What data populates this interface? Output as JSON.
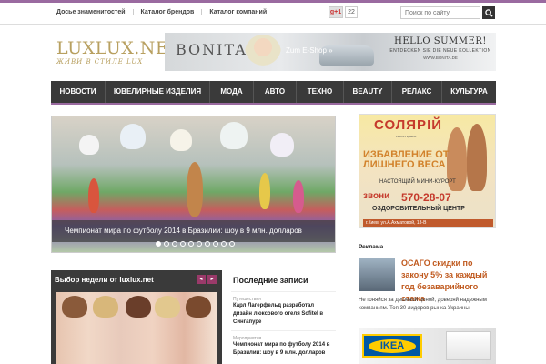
{
  "topbar": {
    "links": [
      "Досье знаменитостей",
      "Каталог брендов",
      "Каталог компаний"
    ],
    "gplus_label": "g+1",
    "gplus_count": "22",
    "search_placeholder": "Поиск по сайту"
  },
  "logo": {
    "name": "LUXLUX.NET",
    "tagline": "ЖИВИ В СТИЛЕ LUX"
  },
  "banner": {
    "brand": "BONITA",
    "shop": "Zum E-Shop »",
    "hello": "HELLO SUMMER!",
    "sub": "ENTDECKEN SIE DIE NEUE KOLLEKTION",
    "url": "WWW.BONITA.DE"
  },
  "nav": {
    "items": [
      "НОВОСТИ",
      "ЮВЕЛИРНЫЕ ИЗДЕЛИЯ",
      "МОДА",
      "АВТО",
      "ТЕХНО",
      "BEAUTY",
      "РЕЛАКС",
      "КУЛЬТУРА"
    ]
  },
  "slider": {
    "caption": "Чемпионат мира по футболу 2014 в Бразилии: шоу в 9 млн. долларов",
    "active_index": 0,
    "dot_count": 10
  },
  "week": {
    "title": "Выбор недели от luxlux.net",
    "prev": "◂",
    "next": "▸"
  },
  "recent": {
    "title": "Последние записи",
    "items": [
      {
        "category": "Путешествия",
        "text": "Карл Лагерфельд разработал дизайн люксового отеля Sofitel в Сингапуре"
      },
      {
        "category": "Мероприятия",
        "text": "Чемпионат мира по футболу 2014 в Бразилии: шоу в 9 млн. долларов"
      }
    ]
  },
  "ad": {
    "title": "СОЛЯРІЙ",
    "subtitle": "салон краси",
    "headline": "ИЗБАВЛЕНИЕ ОТ ЛИШНЕГО ВЕСА",
    "resort": "НАСТОЯЩИЙ МИНИ-КУРОРТ",
    "call": "звони",
    "phone": "570-28-07",
    "center": "ОЗДОРОВИТЕЛЬНЫЙ ЦЕНТР",
    "address": "г.Киев, ул.А.Ахматовой, 13-В"
  },
  "reklama": {
    "label": "Реклама",
    "title": "ОСАГО скидки по закону 5% за каждый год безаварийного стажа",
    "desc": "Не гоняйся за дешевой ценой, доверяй надежным компаниям. Топ 30 лидеров рынка Украины.",
    "ikea": "IKEA"
  },
  "colors": {
    "accent": "#9a6aa0",
    "nav_bg": "#3a3a3a",
    "logo_gold": "#b8a060",
    "link_orange": "#c05a1f"
  }
}
